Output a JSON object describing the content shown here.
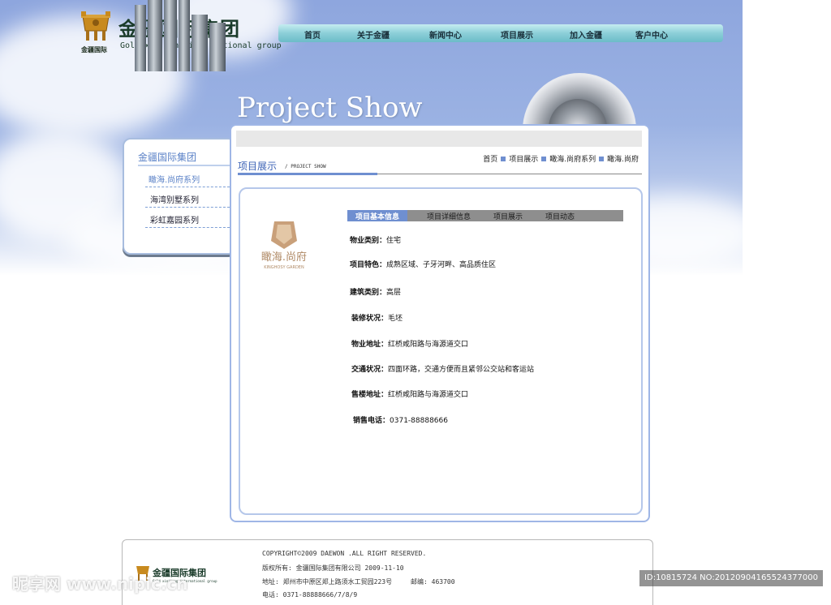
{
  "brand": {
    "small_label": "金疆国际",
    "title": "金疆国际集团",
    "subtitle": "Gold xinjiang international group"
  },
  "nav": {
    "items": [
      "首页",
      "关于金疆",
      "新闻中心",
      "项目展示",
      "加入金疆",
      "客户中心"
    ]
  },
  "hero": {
    "title": "Project Show"
  },
  "sidebar": {
    "title": "金疆国际集团",
    "items": [
      {
        "label": "瞰海.尚府系列",
        "active": true
      },
      {
        "label": "海湾别墅系列",
        "active": false
      },
      {
        "label": "彩虹嘉园系列",
        "active": false
      }
    ]
  },
  "content": {
    "section_title": "项目展示",
    "section_en": "/  PROJECT SHOW",
    "breadcrumb": [
      "首页",
      "项目展示",
      "瞰海.尚府系列",
      "瞰海.尚府"
    ],
    "product_logo": {
      "name": "瞰海.尚府",
      "en": "KINGHOSY GARDEN"
    },
    "tabs": [
      {
        "label": "项目基本信息",
        "active": true
      },
      {
        "label": "项目详细信息",
        "active": false
      },
      {
        "label": "项目展示",
        "active": false
      },
      {
        "label": "项目动态",
        "active": false
      }
    ],
    "info": [
      {
        "label": "物业类别：",
        "value": "住宅"
      },
      {
        "label": "项目特色：",
        "value": "成熟区域、子牙河畔、高品质住区"
      },
      {
        "label": "建筑类别：",
        "value": "高层"
      },
      {
        "label": "装修状况：",
        "value": "毛坯"
      },
      {
        "label": "物业地址：",
        "value": "红桥咸阳路与海源道交口"
      },
      {
        "label": "交通状况：",
        "value": "四面环路，交通方便而且紧邻公交站和客运站"
      },
      {
        "label": "售楼地址：",
        "value": "红桥咸阳路与海源道交口"
      },
      {
        "label": "销售电话：",
        "value": "0371-88888666"
      }
    ]
  },
  "footer": {
    "logo_title": "金疆国际集团",
    "logo_sub": "Gold xinjiang international group",
    "copyright": "COPYRIGHT©2009 DAEWON .ALL RIGHT RESERVED.",
    "owner": "版权所有: 金疆国际集团有限公司 2009-11-10",
    "address": "地址: 郑州市中原区郑上路须水工贸园223号",
    "postcode": "邮编: 463700",
    "phone": "电话: 0371-88888666/7/8/9"
  },
  "watermarks": {
    "left": "昵享网 www.nipic.cn",
    "right": "ID:10815724 NO:20120904165524377000"
  },
  "colors": {
    "accent": "#6f8fd0",
    "nav": "#8ccfd8",
    "brand_green": "#1a3b2a"
  }
}
